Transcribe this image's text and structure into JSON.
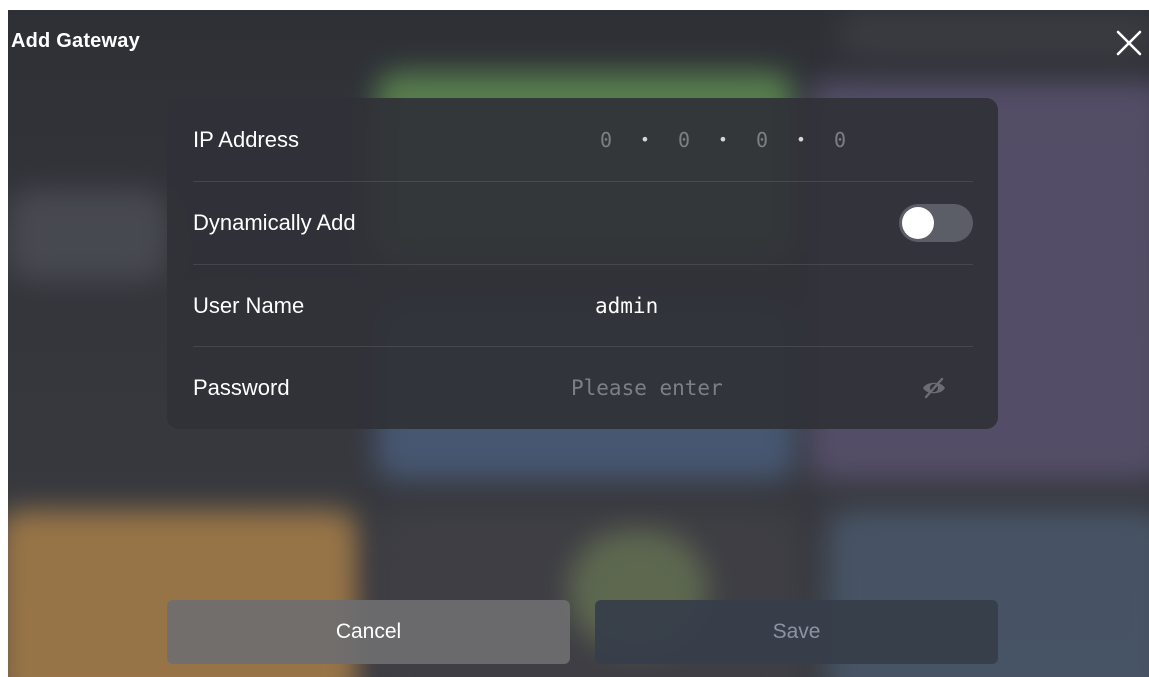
{
  "dialog": {
    "title": "Add Gateway",
    "close_icon": "close-icon"
  },
  "form": {
    "ip": {
      "label": "IP Address",
      "octets": [
        "0",
        "0",
        "0",
        "0"
      ],
      "separator": "•"
    },
    "dynamic": {
      "label": "Dynamically Add",
      "enabled": false
    },
    "username": {
      "label": "User Name",
      "value": "admin"
    },
    "password": {
      "label": "Password",
      "placeholder": "Please enter",
      "value": "",
      "visibility_icon": "eye-off-icon"
    }
  },
  "buttons": {
    "cancel": "Cancel",
    "save": "Save"
  },
  "colors": {
    "accent_disabled_text": "#8c93a1",
    "toggle_off": "#5b5e66"
  }
}
